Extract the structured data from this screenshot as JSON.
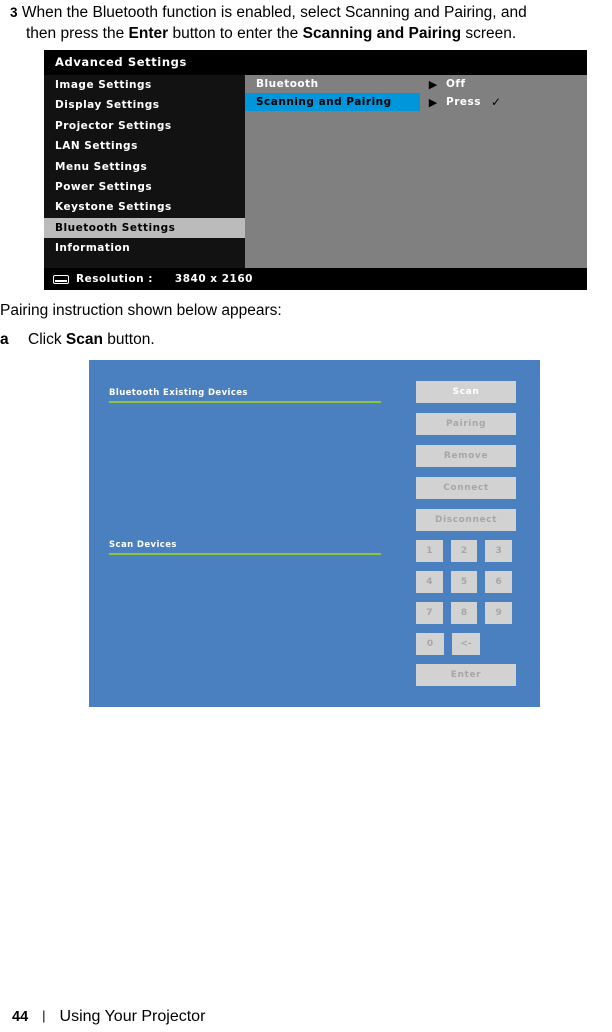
{
  "steps": {
    "step3": {
      "number": "3",
      "line1_a": "When the Bluetooth function is enabled, select Scanning and Pairing, and",
      "line2_a": "then press the ",
      "line2_b": "Enter",
      "line2_c": " button to enter the ",
      "line2_d": "Scanning and Pairing",
      "line2_e": " screen."
    },
    "pairing_note": "Pairing instruction shown below appears:",
    "step_a": {
      "letter": "a",
      "text_a": "Click ",
      "text_b": "Scan",
      "text_c": " button."
    }
  },
  "osd": {
    "title": "Advanced Settings",
    "menu_items": [
      {
        "label": "Image Settings",
        "selected": false
      },
      {
        "label": "Display Settings",
        "selected": false
      },
      {
        "label": "Projector Settings",
        "selected": false
      },
      {
        "label": "LAN Settings",
        "selected": false
      },
      {
        "label": "Menu Settings",
        "selected": false
      },
      {
        "label": "Power Settings",
        "selected": false
      },
      {
        "label": "Keystone Settings",
        "selected": false
      },
      {
        "label": "Bluetooth Settings",
        "selected": true
      },
      {
        "label": "Information",
        "selected": false
      }
    ],
    "submenu": [
      {
        "label": "Bluetooth",
        "arrow": "▶",
        "value": "Off",
        "check": "",
        "active": false
      },
      {
        "label": "Scanning and Pairing",
        "arrow": "▶",
        "value": "Press",
        "check": "✓",
        "active": true
      }
    ],
    "footer": {
      "icon": "resolution-icon",
      "label": "Resolution :",
      "value": "3840 x 2160"
    },
    "colors": {
      "background": "#000000",
      "left_panel": "#121212",
      "right_panel": "#808080",
      "selected_row": "#bbbbbb",
      "active_highlight": "#0096dc"
    }
  },
  "bt_dialog": {
    "sections": [
      {
        "title": "Bluetooth Existing Devices"
      },
      {
        "title": "Scan Devices"
      }
    ],
    "buttons": [
      {
        "label": "Scan",
        "enabled": true
      },
      {
        "label": "Pairing",
        "enabled": false
      },
      {
        "label": "Remove",
        "enabled": false
      },
      {
        "label": "Connect",
        "enabled": false
      },
      {
        "label": "Disconnect",
        "enabled": false
      }
    ],
    "keypad": {
      "rows": [
        [
          "1",
          "2",
          "3"
        ],
        [
          "4",
          "5",
          "6"
        ],
        [
          "7",
          "8",
          "9"
        ],
        [
          "0",
          "<-"
        ]
      ],
      "enter": "Enter"
    },
    "colors": {
      "background": "#4a80bf",
      "rule": "#8fc33a",
      "button": "#d2d2d2",
      "button_text_disabled": "#a7a7a7",
      "button_text_enabled": "#ffffff"
    }
  },
  "page_footer": {
    "page_number": "44",
    "separator": "|",
    "title": "Using Your Projector"
  }
}
